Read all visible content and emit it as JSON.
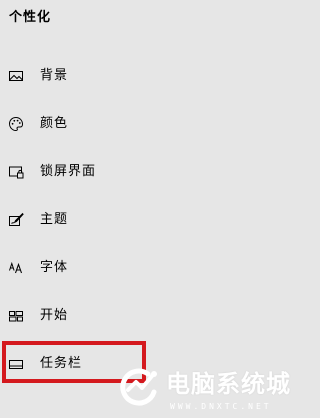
{
  "section_title": "个性化",
  "nav_items": [
    {
      "label": "背景",
      "icon": "picture-icon"
    },
    {
      "label": "颜色",
      "icon": "palette-icon"
    },
    {
      "label": "锁屏界面",
      "icon": "lock-screen-icon"
    },
    {
      "label": "主题",
      "icon": "theme-brush-icon"
    },
    {
      "label": "字体",
      "icon": "font-icon"
    },
    {
      "label": "开始",
      "icon": "start-tiles-icon"
    },
    {
      "label": "任务栏",
      "icon": "taskbar-icon"
    }
  ],
  "highlight_color": "#d4191e",
  "background_color": "#e6e6e6",
  "watermark": {
    "text": "电脑系统城",
    "url": "WWW.DNXTC.NET"
  }
}
